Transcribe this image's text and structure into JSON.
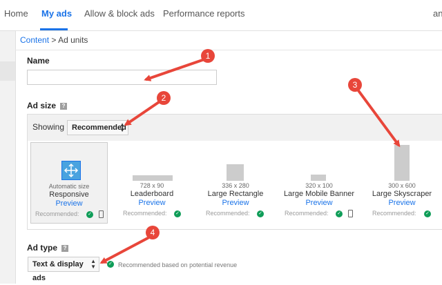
{
  "nav": {
    "home": "Home",
    "my_ads": "My ads",
    "allow_block": "Allow & block ads",
    "performance": "Performance reports",
    "user": "an"
  },
  "breadcrumb": {
    "content": "Content",
    "separator": ">",
    "current": "Ad units"
  },
  "name_section": {
    "label": "Name",
    "help": "?",
    "value": ""
  },
  "ad_size": {
    "label": "Ad size",
    "help": "?",
    "showing_label": "Showing",
    "showing_value": "Recommended",
    "units": [
      {
        "dims": "Automatic size",
        "name": "Responsive",
        "preview": "Preview",
        "recommended": "Recommended:"
      },
      {
        "dims": "728 x 90",
        "name": "Leaderboard",
        "preview": "Preview",
        "recommended": "Recommended:"
      },
      {
        "dims": "336 x 280",
        "name": "Large Rectangle",
        "preview": "Preview",
        "recommended": "Recommended:"
      },
      {
        "dims": "320 x 100",
        "name": "Large Mobile Banner",
        "preview": "Preview",
        "recommended": "Recommended:"
      },
      {
        "dims": "300 x 600",
        "name": "Large Skyscraper",
        "preview": "Preview",
        "recommended": "Recommended:"
      }
    ]
  },
  "ad_type": {
    "label": "Ad type",
    "help": "?",
    "value": "Text & display ads",
    "note": "Recommended based on potential revenue"
  },
  "annotations": [
    "1",
    "2",
    "3",
    "4"
  ],
  "colors": {
    "accent": "#1a73e8",
    "annotation": "#e8463a",
    "check": "#0f9d58"
  }
}
